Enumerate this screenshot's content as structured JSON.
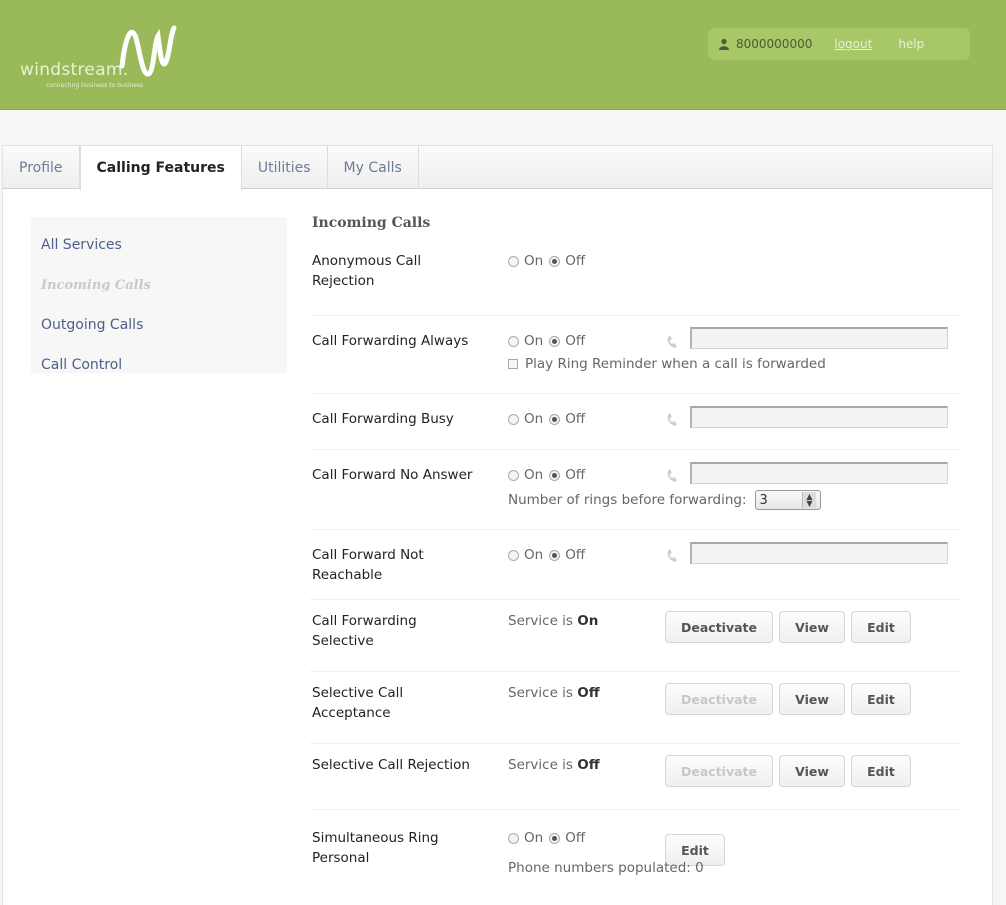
{
  "header": {
    "logo_text": "windstream.",
    "logo_tagline": "connecting business to business",
    "user_number": "8000000000",
    "logout_label": "logout",
    "help_label": "help",
    "brand_color": "#9aba59"
  },
  "tabs": [
    {
      "label": "Profile",
      "active": false
    },
    {
      "label": "Calling Features",
      "active": true
    },
    {
      "label": "Utilities",
      "active": false
    },
    {
      "label": "My Calls",
      "active": false
    }
  ],
  "sidebar": {
    "items": [
      {
        "label": "All Services",
        "active": false
      },
      {
        "label": "Incoming Calls",
        "active": true
      },
      {
        "label": "Outgoing Calls",
        "active": false
      },
      {
        "label": "Call Control",
        "active": false
      }
    ]
  },
  "content": {
    "section_title": "Incoming Calls",
    "on_label": "On",
    "off_label": "Off",
    "service_is_label": "Service is",
    "features": {
      "anonymous_rejection": {
        "label": "Anonymous Call Rejection",
        "state": "Off"
      },
      "forwarding_always": {
        "label": "Call Forwarding Always",
        "state": "Off",
        "number": "",
        "ring_reminder_label": "Play Ring Reminder when a call is forwarded",
        "ring_reminder_checked": false
      },
      "forwarding_busy": {
        "label": "Call Forwarding Busy",
        "state": "Off",
        "number": ""
      },
      "forward_no_answer": {
        "label": "Call Forward No Answer",
        "state": "Off",
        "number": "",
        "rings_label": "Number of rings before forwarding:",
        "rings_value": "3"
      },
      "forward_not_reachable": {
        "label": "Call Forward Not Reachable",
        "state": "Off",
        "number": ""
      },
      "forwarding_selective": {
        "label": "Call Forwarding Selective",
        "service_state": "On"
      },
      "selective_acceptance": {
        "label": "Selective Call Acceptance",
        "service_state": "Off"
      },
      "selective_rejection": {
        "label": "Selective Call Rejection",
        "service_state": "Off"
      },
      "simultaneous_ring": {
        "label": "Simultaneous Ring Personal",
        "state": "Off",
        "populated_label": "Phone numbers populated: 0"
      }
    },
    "buttons": {
      "deactivate": "Deactivate",
      "view": "View",
      "edit": "Edit"
    }
  }
}
